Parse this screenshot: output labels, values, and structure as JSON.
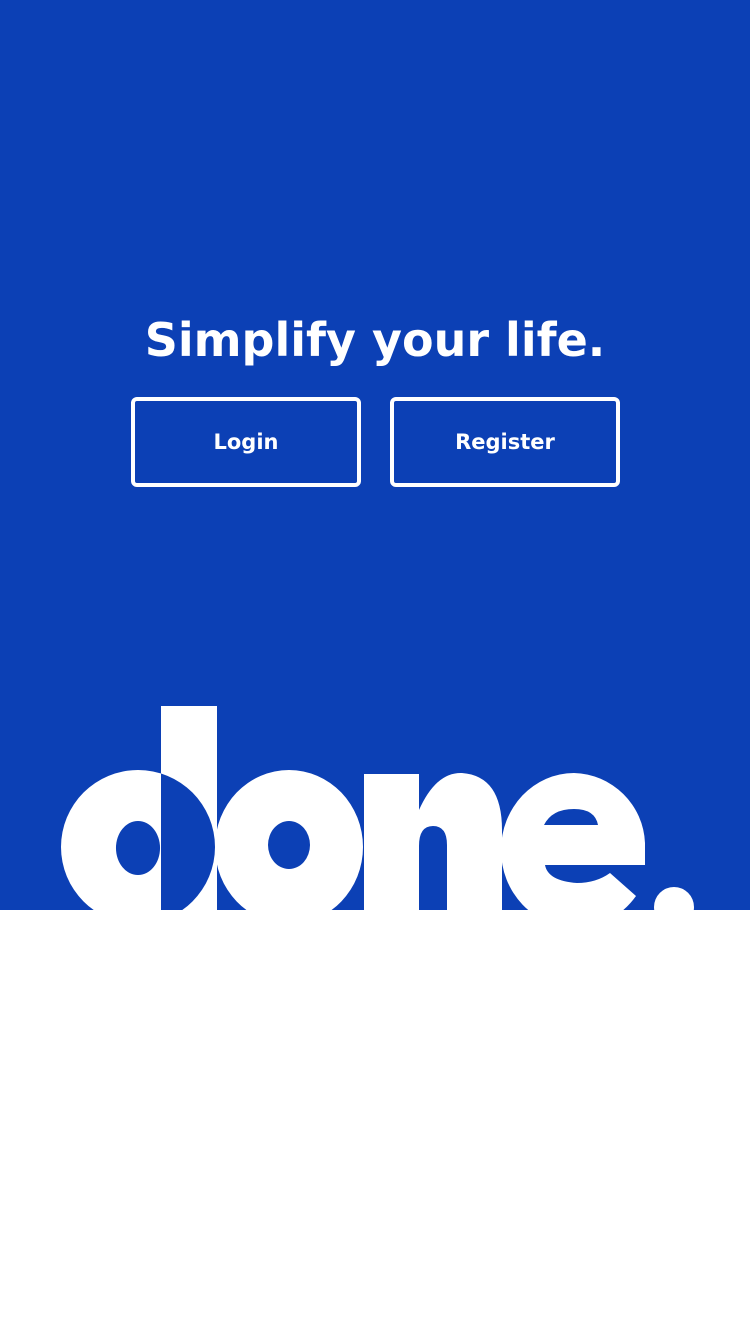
{
  "colors": {
    "brand_blue": "#0c40b5",
    "white": "#ffffff"
  },
  "hero": {
    "tagline": "Simplify your life."
  },
  "actions": {
    "login_label": "Login",
    "register_label": "Register"
  },
  "logo": {
    "wordmark": "done."
  }
}
